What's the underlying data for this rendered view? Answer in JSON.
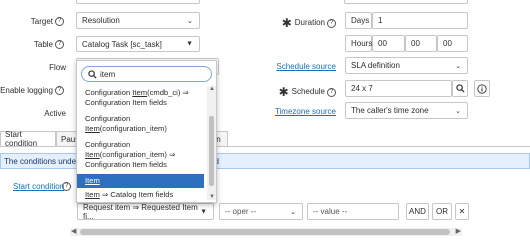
{
  "form": {
    "target": {
      "label": "Target",
      "value": "Resolution"
    },
    "table": {
      "label": "Table",
      "value": "Catalog Task [sc_task]"
    },
    "flow": {
      "label": "Flow"
    },
    "enable_logging": {
      "label": "Enable logging"
    },
    "active": {
      "label": "Active"
    },
    "duration": {
      "label": "Duration",
      "days_label": "Days",
      "days_value": "1",
      "hours_label": "Hours",
      "hh": "00",
      "mm": "00",
      "ss": "00"
    },
    "schedule_source": {
      "label": "Schedule source",
      "value": "SLA definition"
    },
    "schedule": {
      "label": "Schedule",
      "value": "24 x 7"
    },
    "timezone_source": {
      "label": "Timezone source",
      "value": "The caller's time zone"
    }
  },
  "dropdown": {
    "search_value": "item",
    "items": [
      {
        "pre": "Configuration ",
        "u": "Item",
        "post": "(cmdb_ci) ⇒",
        "line2": "Configuration Item fields",
        "selected": false
      },
      {
        "pre": "Configuration",
        "line2u": "Item",
        "line2": "(configuration_item)",
        "selected": false
      },
      {
        "pre": "Configuration",
        "line2u": "Item",
        "line2": "(configuration_item) ⇒",
        "line3": "Configuration Item fields",
        "selected": false
      },
      {
        "u": "Item",
        "selected": true
      },
      {
        "u": "Item",
        "post": " ⇒ Catalog Item fields",
        "selected": false
      }
    ]
  },
  "tabs": [
    "Start condition",
    "Pause",
    "ion"
  ],
  "info_banner": {
    "pre": "The conditions under wh",
    "post": "ed"
  },
  "start_condition": {
    "label": "Start condition",
    "field": "Request item ⇒ Requested Item fi...",
    "oper": "-- oper --",
    "value": "-- value --",
    "and_label": "AND",
    "or_label": "OR",
    "remove_label": "✕"
  },
  "icons": {
    "search": "search-icon",
    "info": "info-icon",
    "caret": "chevron-down-icon"
  }
}
